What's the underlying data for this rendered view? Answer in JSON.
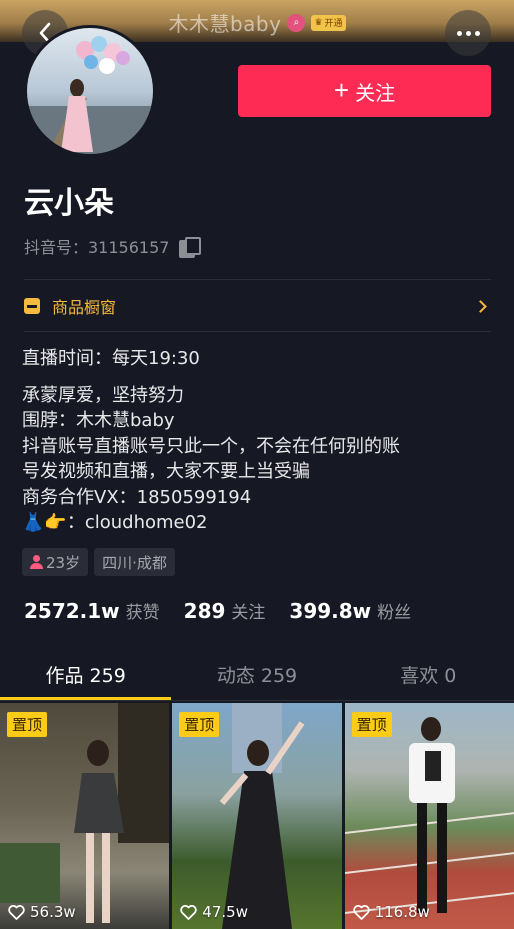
{
  "header": {
    "title": "木木慧baby",
    "badge_label": "开通",
    "back_icon": "chevron-left-icon",
    "more_icon": "ellipsis-icon"
  },
  "profile": {
    "nickname": "云小朵",
    "douyin_id": "抖音号：31156157",
    "follow_button": "关注"
  },
  "shop": {
    "label": "商品橱窗"
  },
  "bio": {
    "live_time": "直播时间：每天19:30",
    "lines": [
      "承蒙厚爱，坚持努力",
      "围脖：木木慧baby",
      "抖音账号直播账号只此一个，不会在任何别的账",
      "号发视频和直播，大家不要上当受骗",
      "商务合作VX：1850599194"
    ],
    "contact_emoji": "👗👉",
    "contact_text": "：cloudhome02"
  },
  "tags": {
    "age": "23岁",
    "location": "四川·成都"
  },
  "stats": {
    "likes_num": "2572.1w",
    "likes_label": "获赞",
    "following_num": "289",
    "following_label": "关注",
    "followers_num": "399.8w",
    "followers_label": "粉丝"
  },
  "tabs": [
    {
      "label": "作品 259"
    },
    {
      "label": "动态 259"
    },
    {
      "label": "喜欢 0"
    }
  ],
  "videos": [
    {
      "pin": "置顶",
      "likes": "56.3w"
    },
    {
      "pin": "置顶",
      "likes": "47.5w"
    },
    {
      "pin": "置顶",
      "likes": "116.8w"
    }
  ],
  "colors": {
    "background": "#161823",
    "follow_button": "#fe2c55",
    "accent_yellow": "#facc15",
    "shop_accent": "#f5b93d"
  }
}
